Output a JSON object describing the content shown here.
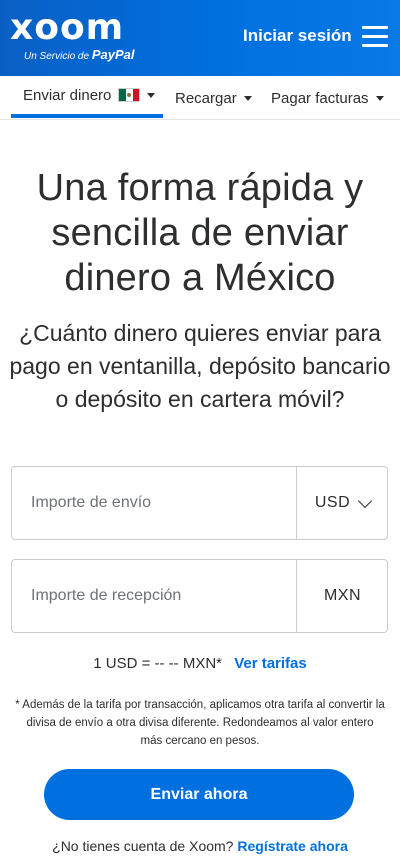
{
  "header": {
    "logo_text": "xoom",
    "logo_tagline_prefix": "Un Servicio de",
    "logo_tagline_brand": "PayPal",
    "signin_label": "Iniciar sesión",
    "menu_icon": "hamburger-menu-icon"
  },
  "nav": {
    "items": [
      {
        "label": "Enviar dinero",
        "active": true,
        "flag": "mexico-flag-icon"
      },
      {
        "label": "Recargar",
        "active": false
      },
      {
        "label": "Pagar facturas",
        "active": false
      }
    ],
    "accent_color": "#0070e0"
  },
  "main": {
    "title": "Una forma rápida y sencilla de enviar dinero a México",
    "subtitle": "¿Cuánto dinero quieres enviar para pago en ventanilla, depósito bancario o depósito en cartera móvil?",
    "send_field": {
      "placeholder": "Importe de envío",
      "value": "",
      "currency": "USD"
    },
    "receive_field": {
      "placeholder": "Importe de recepción",
      "value": "",
      "currency": "MXN"
    },
    "rate_text": "1 USD = -- -- MXN*",
    "rate_link": "Ver tarifas",
    "note": "* Además de la tarifa por transacción, aplicamos otra tarifa al convertir la divisa de envío a otra divisa diferente. Redondeamos al valor entero más cercano en pesos.",
    "cta_label": "Enviar ahora",
    "signup_prompt": "¿No tienes cuenta de Xoom?",
    "signup_link": "Regístrate ahora"
  }
}
